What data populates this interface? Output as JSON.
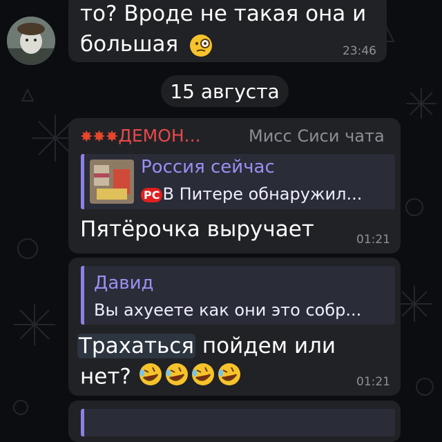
{
  "messages": {
    "prev": {
      "line1": "то? Вроде не такая она и",
      "line2": "большая",
      "emoji": "thinking-monocle",
      "time": "23:46"
    },
    "date_separator": "15 августа",
    "msg1": {
      "sender_name": "ДЕМОН...",
      "sender_emoji": "💥",
      "sender_badge": "Мисс Сиси чата",
      "quote": {
        "name": "Россия сейчас",
        "logo": "РС",
        "text": "В Питере обнаружил..."
      },
      "text": "Пятёрочка выручает",
      "time": "01:21"
    },
    "msg2": {
      "quote": {
        "name": "Давид",
        "text": "Вы ахуеете как они это собр..."
      },
      "text_line1_highlight": "Трахаться",
      "text_line1_rest": " пойдем или",
      "text_line2": "нет?",
      "emoji": "rolling-on-floor-laughing",
      "time": "01:21"
    }
  },
  "colors": {
    "bubble": "#212226",
    "quote_bg": "#2a2c37",
    "accent": "#8b81e8",
    "sender": "#e64a4a"
  }
}
